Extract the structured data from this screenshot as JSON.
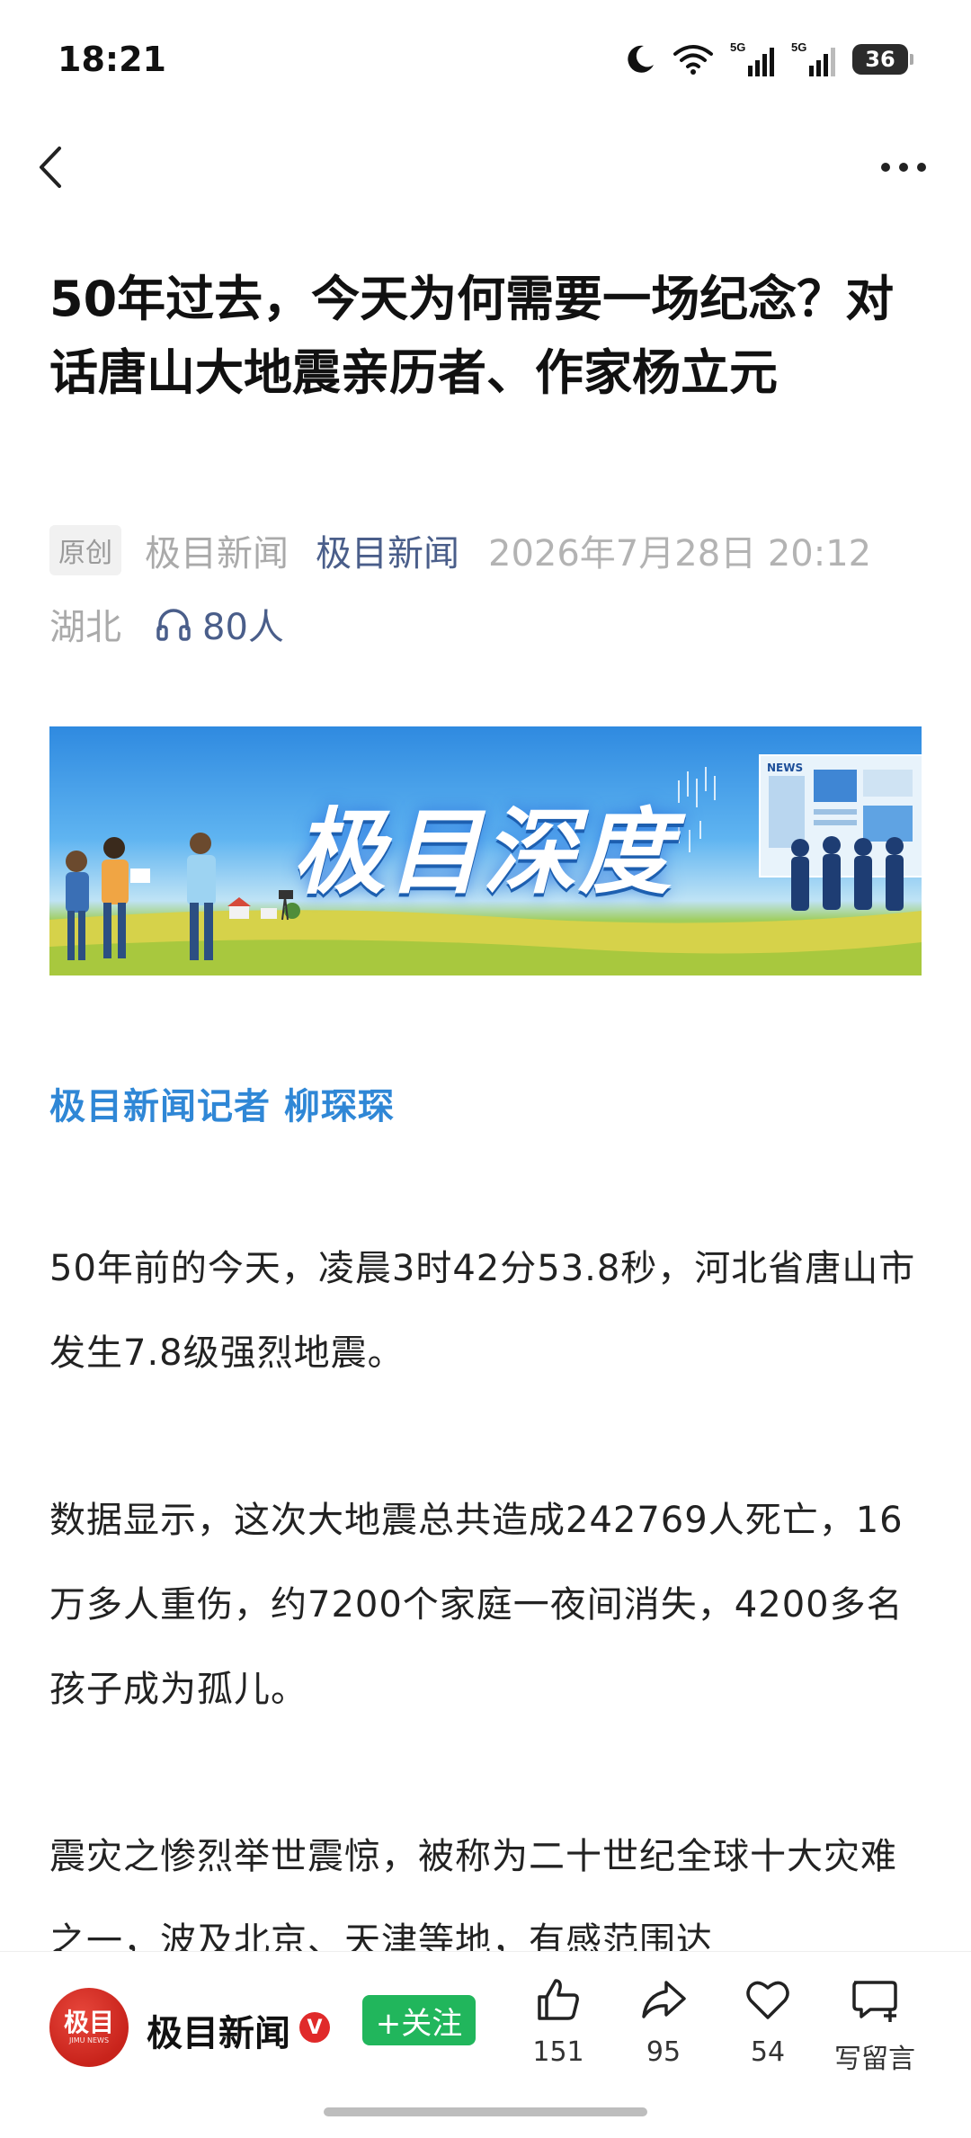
{
  "status_bar": {
    "time": "18:21",
    "signal1_label": "5G",
    "signal2_label": "5G",
    "battery": "36"
  },
  "article": {
    "title": "50年过去，今天为何需要一场纪念？对话唐山大地震亲历者、作家杨立元",
    "original_badge": "原创",
    "source": "极目新闻",
    "account": "极目新闻",
    "datetime": "2026年7月28日 20:12",
    "location": "湖北",
    "listeners": "80人",
    "banner_title": "极目深度",
    "banner_news_label": "NEWS",
    "reporter": "极目新闻记者 柳琛琛",
    "paragraphs": [
      "50年前的今天，凌晨3时42分53.8秒，河北省唐山市发生7.8级强烈地震。",
      "数据显示，这次大地震总共造成242769人死亡，16万多人重伤，约7200个家庭一夜间消失，4200多名孩子成为孤儿。",
      "震灾之惨烈举世震惊，被称为二十世纪全球十大灾难之一，波及北京、天津等地，有感范围达"
    ]
  },
  "bottom_bar": {
    "avatar_text": "极目",
    "avatar_sub": "JIMU NEWS",
    "account_name": "极目新闻",
    "verified_mark": "V",
    "follow_label": "+关注",
    "like_count": "151",
    "share_count": "95",
    "fav_count": "54",
    "comment_label": "写留言"
  },
  "colors": {
    "accent_blue": "#2f87d6",
    "account_blue": "#4a5e8a",
    "follow_green": "#21b65c",
    "verified_red": "#e02a2a"
  },
  "icons": [
    "back-icon",
    "more-icon",
    "moon-icon",
    "wifi-icon",
    "signal-icon",
    "headphones-icon",
    "like-icon",
    "share-icon",
    "favorite-icon",
    "comment-icon"
  ]
}
